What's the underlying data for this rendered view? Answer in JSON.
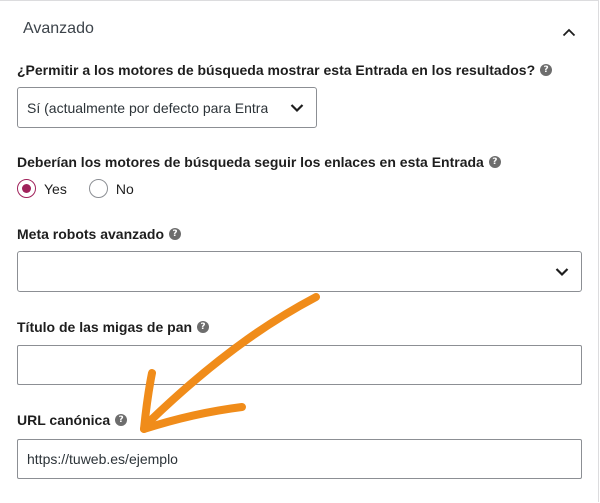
{
  "section": {
    "title": "Avanzado",
    "collapse_icon": "chevron-up-icon"
  },
  "fields": {
    "search_visibility": {
      "label": "¿Permitir a los motores de búsqueda mostrar esta Entrada en los resultados?",
      "help": "?",
      "selected": "Sí (actualmente por defecto para Entra"
    },
    "follow_links": {
      "label": "Deberían los motores de búsqueda seguir los enlaces en esta Entrada",
      "help": "?",
      "options": [
        {
          "label": "Yes",
          "checked": true
        },
        {
          "label": "No",
          "checked": false
        }
      ]
    },
    "meta_robots": {
      "label": "Meta robots avanzado",
      "help": "?",
      "selected": ""
    },
    "breadcrumb_title": {
      "label": "Título de las migas de pan",
      "help": "?",
      "value": ""
    },
    "canonical_url": {
      "label": "URL canónica",
      "help": "?",
      "value": "https://tuweb.es/ejemplo"
    }
  },
  "colors": {
    "accent": "#a0225b",
    "annotation_arrow": "#f08c1a"
  }
}
